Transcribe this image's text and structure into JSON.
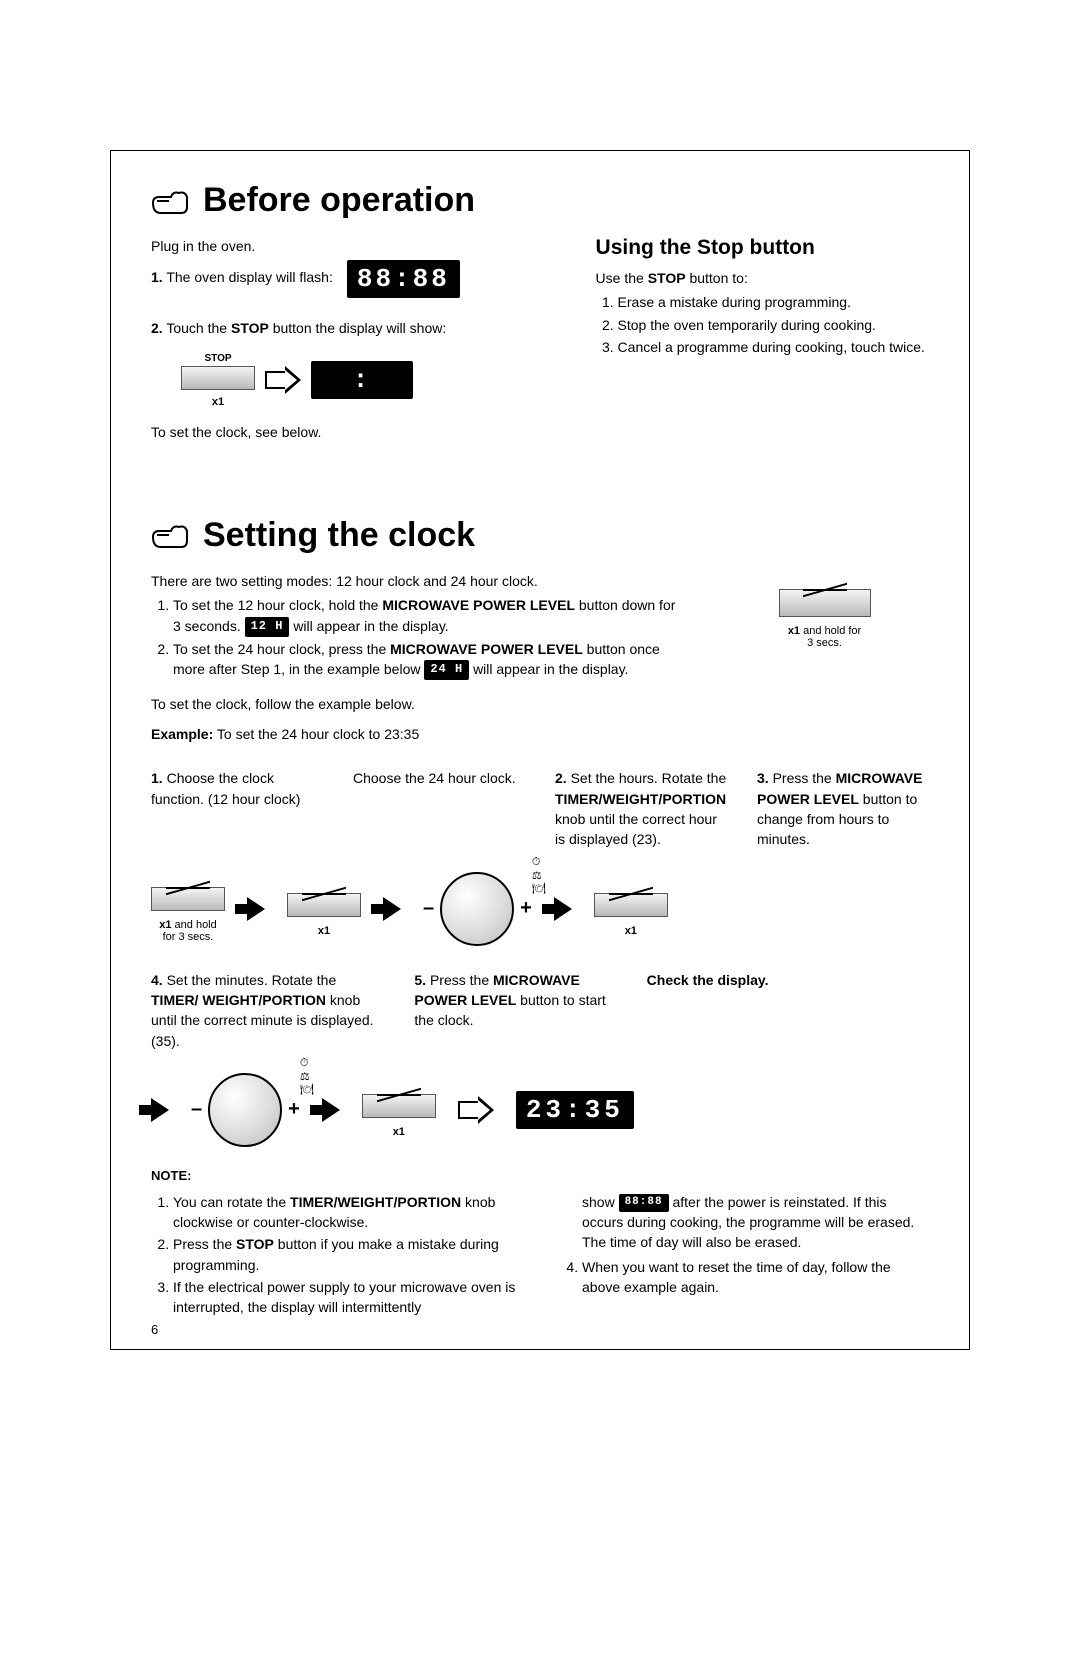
{
  "page_number": "6",
  "section1": {
    "title": "Before operation",
    "intro": "Plug in the oven.",
    "item1": "The oven display will flash:",
    "disp_flash": "88:88",
    "item2_pre": "Touch the ",
    "item2_stop": "STOP",
    "item2_post": " button the display will show:",
    "stop_label": "STOP",
    "x1": "x1",
    "disp_colon": ":",
    "outro": "To set the clock, see below.",
    "right": {
      "title": "Using the Stop button",
      "lead_pre": "Use the ",
      "lead_stop": "STOP",
      "lead_post": " button to:",
      "li1": "Erase a mistake during programming.",
      "li2": "Stop the oven temporarily during cooking.",
      "li3": "Cancel a programme during cooking, touch twice."
    }
  },
  "section2": {
    "title": "Setting the clock",
    "intro": "There are two setting modes: 12 hour clock and 24 hour clock.",
    "m1_a": "To set the 12 hour clock, hold the ",
    "m1_b": "MICROWAVE POWER LEVEL",
    "m1_c": " button down for 3 seconds. ",
    "m1_disp": "12 H",
    "m1_d": " will appear in the display.",
    "m2_a": "To set the 24 hour clock, press the ",
    "m2_b": "MICROWAVE POWER LEVEL",
    "m2_c": " button once more after Step 1, in the example below ",
    "m2_disp": "24 H",
    "m2_d": " will appear in the display.",
    "right_btn_x1": "x1",
    "right_btn_hold": " and hold for",
    "right_btn_hold2": "3 secs.",
    "follow": "To set the clock, follow the example below.",
    "example_label": "Example:",
    "example_text": " To set the 24 hour clock to 23:35",
    "step1a": "Choose the clock function. (12 hour clock)",
    "step1b": "Choose the 24 hour clock.",
    "step2_a": "Set the hours. Rotate the ",
    "step2_b": "TIMER/WEIGHT/PORTION",
    "step2_c": " knob until the correct hour is displayed (23).",
    "step3_a": "Press the ",
    "step3_b": "MICROWAVE POWER LEVEL",
    "step3_c": " button to change from hours to minutes.",
    "step4_a": "Set the minutes. Rotate the ",
    "step4_b": "TIMER/ WEIGHT/PORTION",
    "step4_c": " knob until the correct minute is displayed. (35).",
    "step5_a": "Press the ",
    "step5_b": "MICROWAVE POWER LEVEL",
    "step5_c": " button to start the clock.",
    "check": "Check the display.",
    "check_disp": "23:35",
    "fig_x1": "x1",
    "fig_x1_hold_a": "x1",
    "fig_x1_hold_b": " and hold",
    "fig_x1_hold_c": "for 3 secs.",
    "minus": "–",
    "plus": "+"
  },
  "note": {
    "head": "NOTE:",
    "l1_a": "You can rotate the ",
    "l1_b": "TIMER/WEIGHT/PORTION",
    "l1_c": " knob clockwise or counter-clockwise.",
    "l2_a": "Press the ",
    "l2_b": "STOP",
    "l2_c": " button if you make a mistake during programming.",
    "l3": "If the electrical power supply to your microwave oven is interrupted, the display will intermittently",
    "r3_a": "show ",
    "r3_disp": "88:88",
    "r3_b": " after the power is reinstated. If this occurs during cooking, the programme will be erased. The time of day will also be erased.",
    "l4": "When you want to reset the time of day, follow the above example again."
  }
}
